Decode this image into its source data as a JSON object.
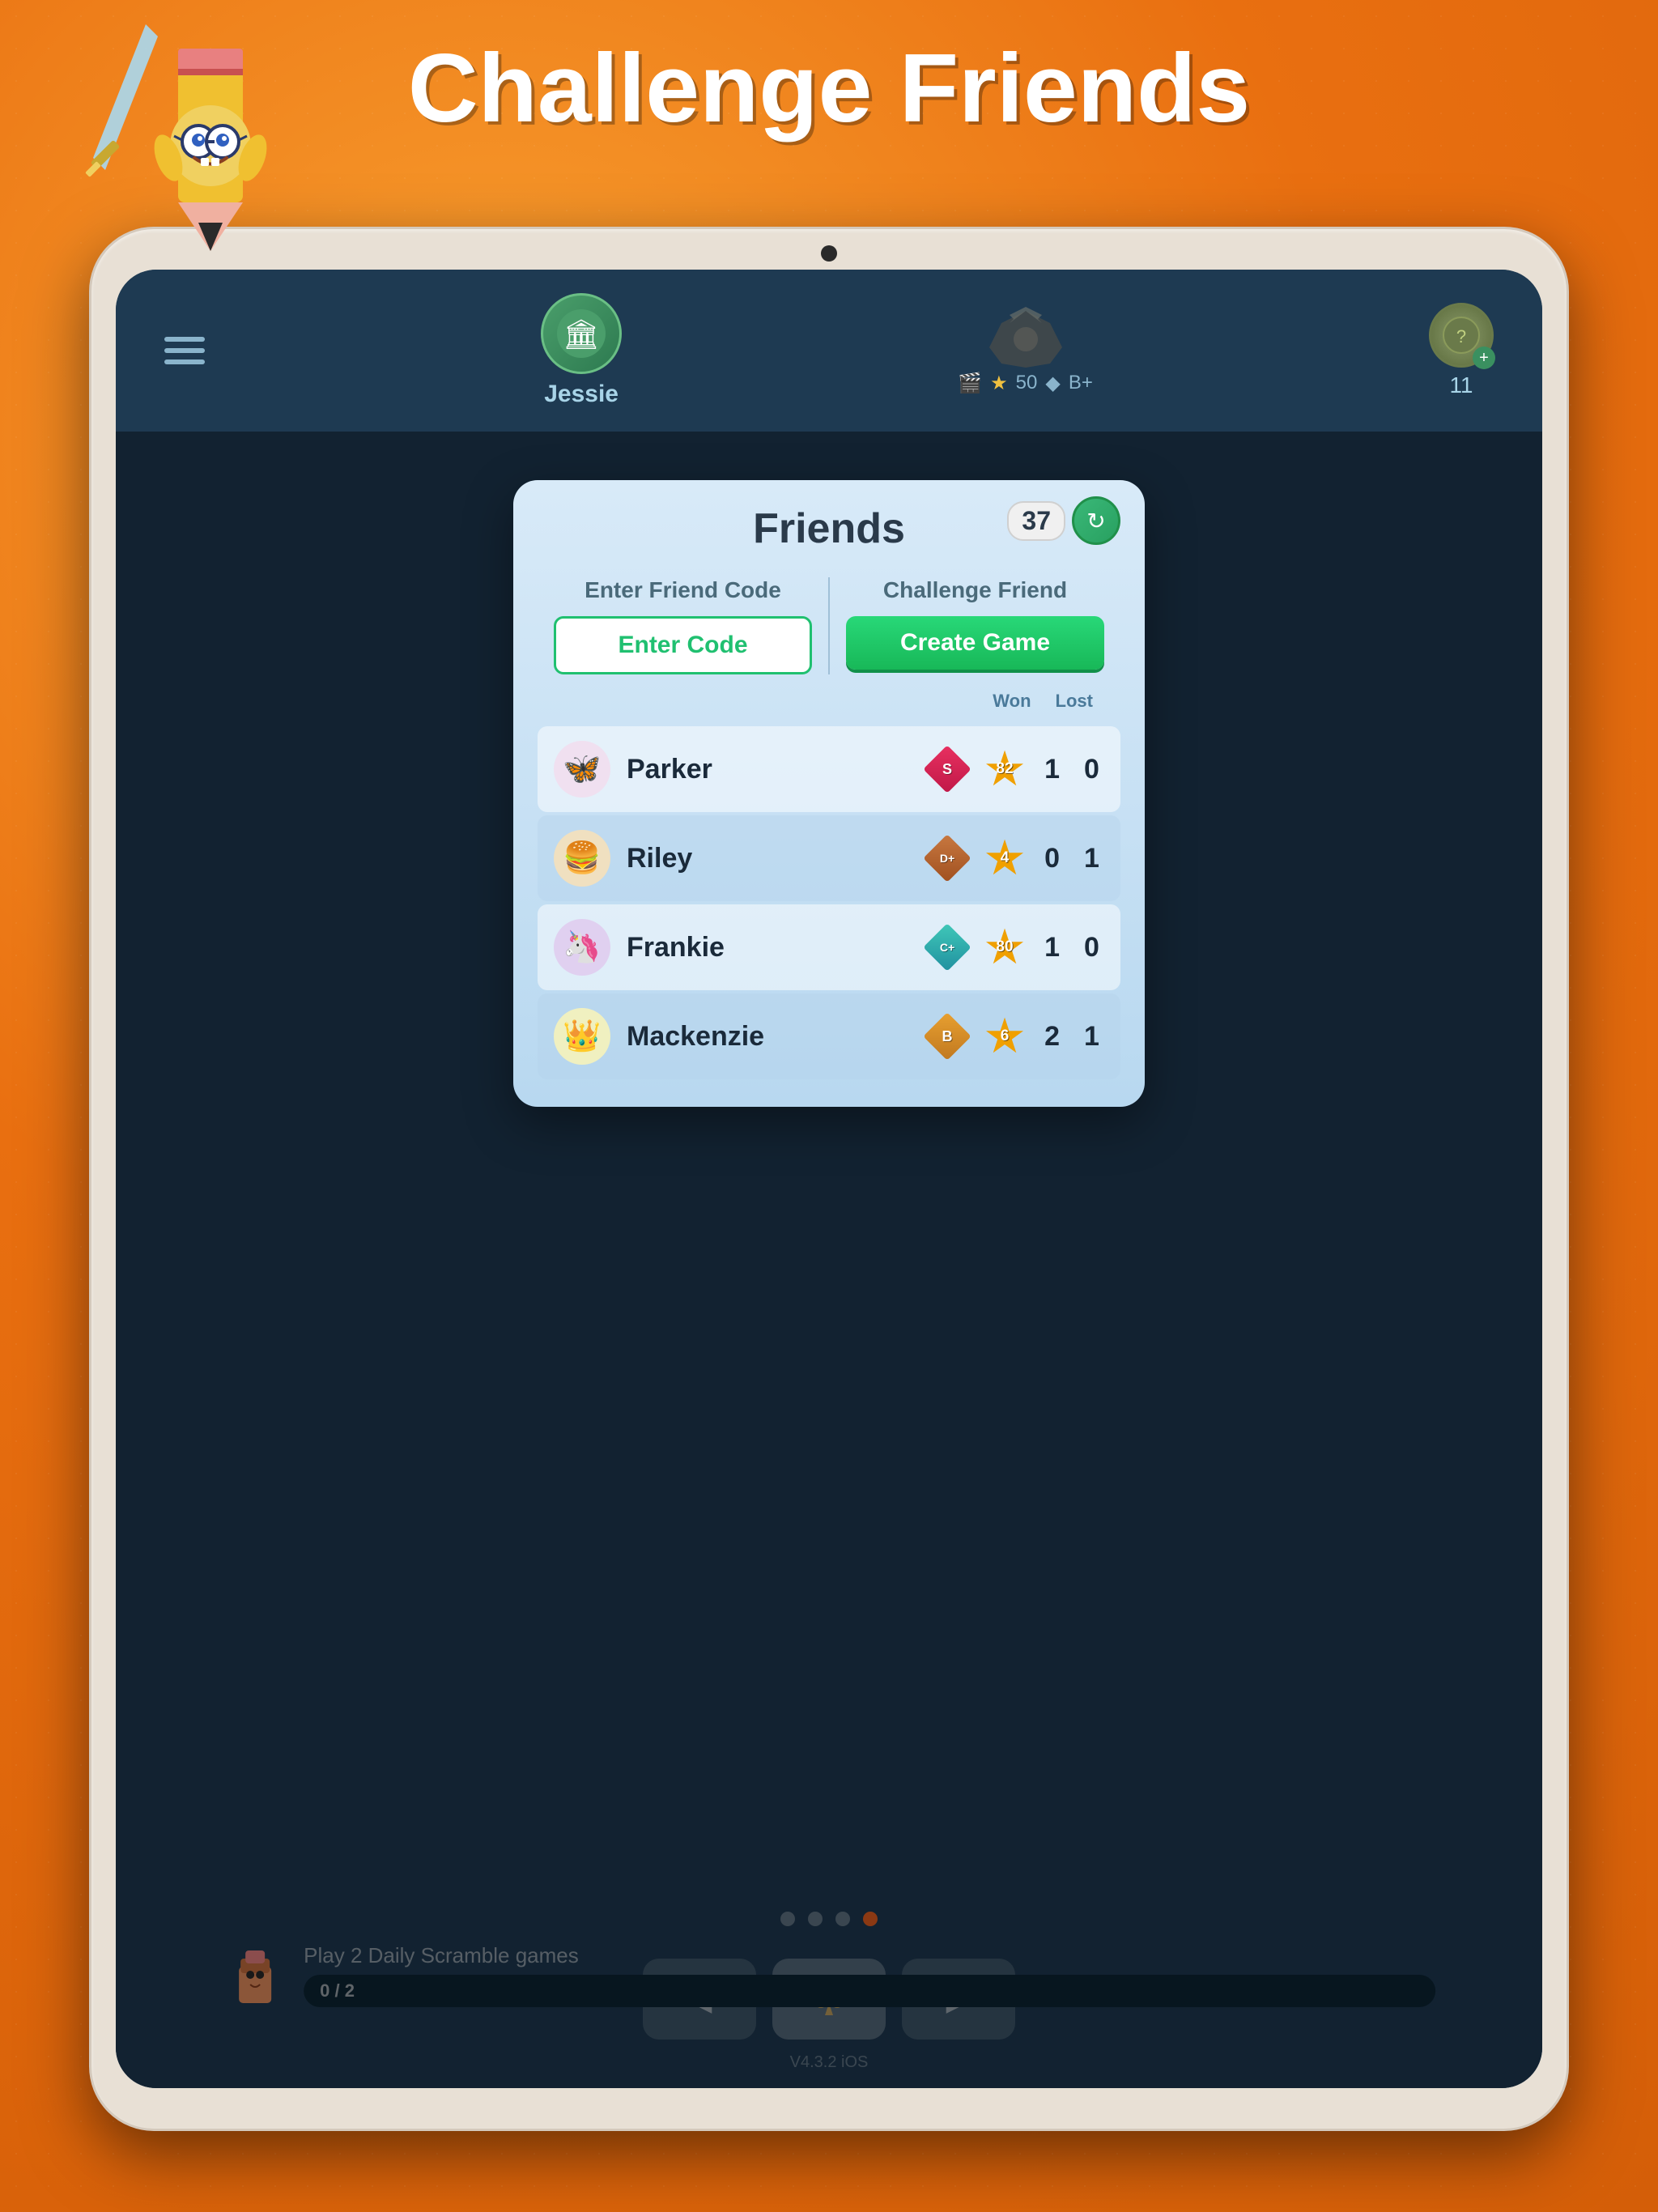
{
  "page": {
    "title": "Challenge Friends",
    "background_color": "#f47b1e"
  },
  "header": {
    "player_name": "Jessie",
    "rank_stars": "50",
    "rank_grade": "B+",
    "coins": "11",
    "menu_icon": "☰"
  },
  "dialog": {
    "title": "Friends",
    "friend_count": "37",
    "left_column_label": "Enter Friend Code",
    "enter_code_button": "Enter Code",
    "right_column_label": "Challenge Friend",
    "create_game_button": "Create Game",
    "friends": [
      {
        "name": "Parker",
        "avatar": "🦋",
        "rank_type": "S",
        "rank_color": "#e83060",
        "star_value": "82",
        "star_color": "#f0a000",
        "won": "1",
        "lost": "0"
      },
      {
        "name": "Riley",
        "avatar": "🍔",
        "rank_type": "D+",
        "rank_color": "#c87840",
        "star_value": "4",
        "star_color": "#f0a000",
        "won": "0",
        "lost": "1"
      },
      {
        "name": "Frankie",
        "avatar": "🦄",
        "rank_type": "C+",
        "rank_color": "#40c8b8",
        "star_value": "80",
        "star_color": "#f0a000",
        "won": "1",
        "lost": "0"
      },
      {
        "name": "Mackenzie",
        "avatar": "👑",
        "rank_type": "B",
        "rank_color": "#e8a030",
        "star_value": "6",
        "star_color": "#f0a000",
        "won": "2",
        "lost": "1"
      }
    ],
    "won_label": "Won",
    "lost_label": "Lost"
  },
  "bottom_nav": {
    "buttons": [
      "◀",
      "♣",
      "▶"
    ]
  },
  "daily_quest": {
    "label": "Play 2 Daily Scramble games",
    "progress": "0 / 2"
  },
  "version": "V4.3.2 iOS",
  "page_dots": 4,
  "active_dot": 3
}
